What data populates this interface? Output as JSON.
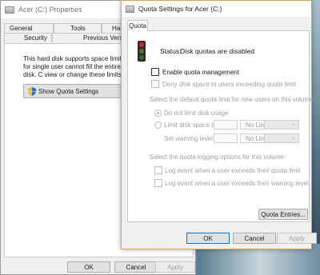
{
  "back_window": {
    "title": "Acer (C:) Properties",
    "tabs_row1": [
      "General",
      "Tools",
      "Hard"
    ],
    "tabs_row2": [
      "Security",
      "Previous Version"
    ],
    "info_text": "This hard disk supports space limits for single user cannot fill the entire disk. C view or change these limits.",
    "show_quota_button": "Show Quota Settings",
    "ok": "OK",
    "cancel": "Cancel",
    "apply": "Apply"
  },
  "dialog": {
    "title": "Quota Settings for Acer (C:)",
    "tab": "Quota",
    "status_label": "Status:",
    "status_text": "Disk quotas are disabled",
    "enable_quota": "Enable quota management",
    "deny_space": "Deny disk space to users exceeding quota limit",
    "default_limit_heading": "Select the default quota limit for new users on this volume:",
    "do_not_limit": "Do not limit disk usage",
    "limit_disk_space": "Limit disk space to",
    "set_warning": "Set warning level to",
    "limit_value": "No Limit",
    "warning_value": "No Limit",
    "logging_heading": "Select the quota logging options for this volume:",
    "log_quota": "Log event when a user exceeds their quota limit",
    "log_warning": "Log event when a user exceeds their warning level",
    "quota_entries": "Quota Entries...",
    "ok": "OK",
    "cancel": "Cancel",
    "apply": "Apply"
  },
  "colors": {
    "accent_border": "#e3a33a",
    "default_button_border": "#0078d7"
  }
}
